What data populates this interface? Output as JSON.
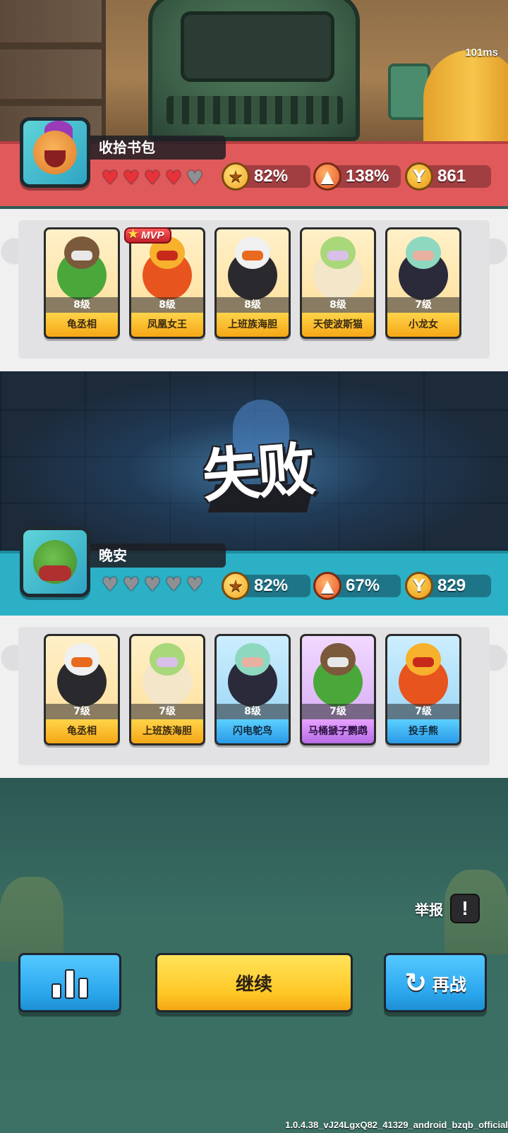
{
  "hud": {
    "ping": "101ms"
  },
  "players": [
    {
      "name": "收拾书包",
      "hearts": {
        "full": 4,
        "total": 5
      },
      "star_rate": "82%",
      "rank_rate": "138%",
      "trophies": "861",
      "team": [
        {
          "name": "龟丞相",
          "level": "8级",
          "rarity": "gold"
        },
        {
          "name": "凤凰女王",
          "level": "8级",
          "rarity": "gold",
          "mvp": "MVP"
        },
        {
          "name": "上班族海胆",
          "level": "8级",
          "rarity": "gold"
        },
        {
          "name": "天使波斯猫",
          "level": "8级",
          "rarity": "gold"
        },
        {
          "name": "小龙女",
          "level": "7级",
          "rarity": "gold"
        }
      ]
    },
    {
      "name": "晚安",
      "hearts": {
        "full": 0,
        "total": 5
      },
      "star_rate": "82%",
      "rank_rate": "67%",
      "trophies": "829",
      "team": [
        {
          "name": "龟丞相",
          "level": "7级",
          "rarity": "gold"
        },
        {
          "name": "上班族海胆",
          "level": "7级",
          "rarity": "gold"
        },
        {
          "name": "闪电鸵鸟",
          "level": "8级",
          "rarity": "blue"
        },
        {
          "name": "马桶搋子鹦鹉",
          "level": "7级",
          "rarity": "purple"
        },
        {
          "name": "投手熊",
          "level": "7级",
          "rarity": "blue"
        }
      ]
    }
  ],
  "result": {
    "text": "失败"
  },
  "report": {
    "label": "举报",
    "icon": "exclamation-icon"
  },
  "buttons": {
    "stats_icon": "bar-chart-icon",
    "continue": "继续",
    "rematch": "再战",
    "rematch_icon": "refresh-icon"
  },
  "footer": {
    "version": "1.0.4.38_vJ24LgxQ82_41329_android_bzqb_official"
  },
  "colors": {
    "player1_band": "#e05a5b",
    "player2_band": "#2bb0c6",
    "heart_full": "#e8323a",
    "heart_empty": "#8f8f96",
    "button_blue": "#2aa6ec",
    "button_yellow": "#ffc726"
  }
}
